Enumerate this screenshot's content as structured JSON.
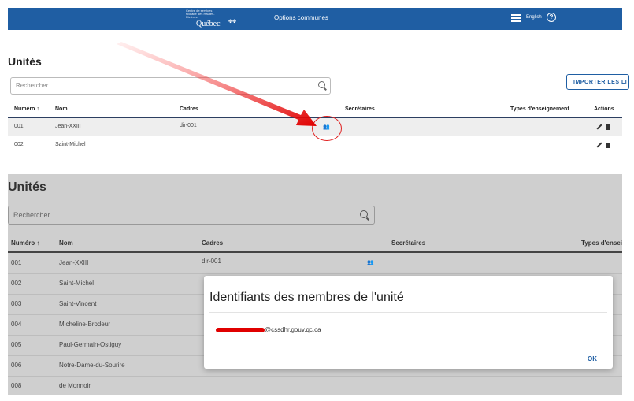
{
  "header": {
    "logo_small": "Centre de services scolaire des Hautes-Rivières",
    "logo_word": "Québec",
    "logo_flag": "✤✤",
    "title": "Options communes",
    "lang": "English",
    "help": "?"
  },
  "top": {
    "page_title": "Unités",
    "search_placeholder": "Rechercher",
    "import_label": "IMPORTER LES LI",
    "columns": [
      "Numéro ↑",
      "Nom",
      "Cadres",
      "Secrétaires",
      "Types d'enseignement",
      "Actions"
    ],
    "rows": [
      {
        "num": "001",
        "name": "Jean-XXIII",
        "cadres": "dir-001"
      },
      {
        "num": "002",
        "name": "Saint-Michel",
        "cadres": ""
      }
    ]
  },
  "bottom": {
    "page_title": "Unités",
    "search_placeholder": "Rechercher",
    "columns": [
      "Numéro ↑",
      "Nom",
      "Cadres",
      "Secrétaires",
      "Types d'enseig"
    ],
    "rows": [
      {
        "num": "001",
        "name": "Jean-XXIII",
        "cadres": "dir-001"
      },
      {
        "num": "002",
        "name": "Saint-Michel",
        "cadres": ""
      },
      {
        "num": "003",
        "name": "Saint-Vincent",
        "cadres": ""
      },
      {
        "num": "004",
        "name": "Micheline-Brodeur",
        "cadres": ""
      },
      {
        "num": "005",
        "name": "Paul-Germain-Ostiguy",
        "cadres": ""
      },
      {
        "num": "006",
        "name": "Notre-Dame-du-Sourire",
        "cadres": ""
      },
      {
        "num": "008",
        "name": "de Monnoir",
        "cadres": ""
      }
    ]
  },
  "dialog": {
    "title": "Identifiants des membres de l'unité",
    "email_suffix": "@cssdhr.gouv.qc.ca",
    "ok": "OK"
  },
  "colors": {
    "header_bg": "#1f5ea3",
    "accent": "#1f5ea3",
    "annotation": "#e02020"
  },
  "icons": {
    "people": "group-icon",
    "edit": "pencil-icon",
    "delete": "trash-icon",
    "search": "search-icon",
    "menu": "hamburger-icon",
    "help": "help-circle-icon"
  }
}
